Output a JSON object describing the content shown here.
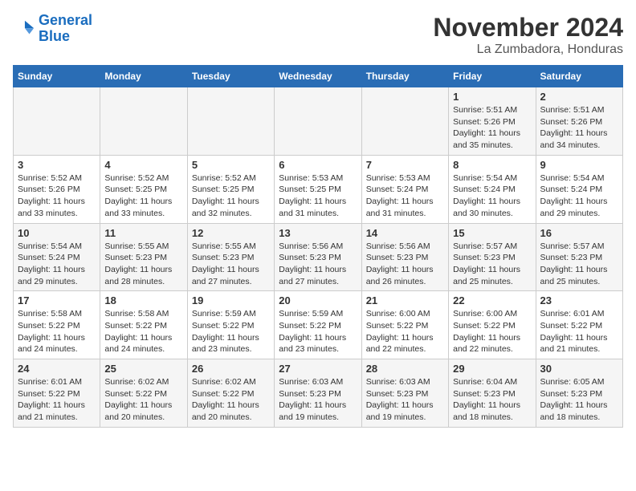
{
  "logo": {
    "line1": "General",
    "line2": "Blue"
  },
  "title": "November 2024",
  "subtitle": "La Zumbadora, Honduras",
  "weekdays": [
    "Sunday",
    "Monday",
    "Tuesday",
    "Wednesday",
    "Thursday",
    "Friday",
    "Saturday"
  ],
  "weeks": [
    [
      {
        "day": "",
        "info": ""
      },
      {
        "day": "",
        "info": ""
      },
      {
        "day": "",
        "info": ""
      },
      {
        "day": "",
        "info": ""
      },
      {
        "day": "",
        "info": ""
      },
      {
        "day": "1",
        "info": "Sunrise: 5:51 AM\nSunset: 5:26 PM\nDaylight: 11 hours\nand 35 minutes."
      },
      {
        "day": "2",
        "info": "Sunrise: 5:51 AM\nSunset: 5:26 PM\nDaylight: 11 hours\nand 34 minutes."
      }
    ],
    [
      {
        "day": "3",
        "info": "Sunrise: 5:52 AM\nSunset: 5:26 PM\nDaylight: 11 hours\nand 33 minutes."
      },
      {
        "day": "4",
        "info": "Sunrise: 5:52 AM\nSunset: 5:25 PM\nDaylight: 11 hours\nand 33 minutes."
      },
      {
        "day": "5",
        "info": "Sunrise: 5:52 AM\nSunset: 5:25 PM\nDaylight: 11 hours\nand 32 minutes."
      },
      {
        "day": "6",
        "info": "Sunrise: 5:53 AM\nSunset: 5:25 PM\nDaylight: 11 hours\nand 31 minutes."
      },
      {
        "day": "7",
        "info": "Sunrise: 5:53 AM\nSunset: 5:24 PM\nDaylight: 11 hours\nand 31 minutes."
      },
      {
        "day": "8",
        "info": "Sunrise: 5:54 AM\nSunset: 5:24 PM\nDaylight: 11 hours\nand 30 minutes."
      },
      {
        "day": "9",
        "info": "Sunrise: 5:54 AM\nSunset: 5:24 PM\nDaylight: 11 hours\nand 29 minutes."
      }
    ],
    [
      {
        "day": "10",
        "info": "Sunrise: 5:54 AM\nSunset: 5:24 PM\nDaylight: 11 hours\nand 29 minutes."
      },
      {
        "day": "11",
        "info": "Sunrise: 5:55 AM\nSunset: 5:23 PM\nDaylight: 11 hours\nand 28 minutes."
      },
      {
        "day": "12",
        "info": "Sunrise: 5:55 AM\nSunset: 5:23 PM\nDaylight: 11 hours\nand 27 minutes."
      },
      {
        "day": "13",
        "info": "Sunrise: 5:56 AM\nSunset: 5:23 PM\nDaylight: 11 hours\nand 27 minutes."
      },
      {
        "day": "14",
        "info": "Sunrise: 5:56 AM\nSunset: 5:23 PM\nDaylight: 11 hours\nand 26 minutes."
      },
      {
        "day": "15",
        "info": "Sunrise: 5:57 AM\nSunset: 5:23 PM\nDaylight: 11 hours\nand 25 minutes."
      },
      {
        "day": "16",
        "info": "Sunrise: 5:57 AM\nSunset: 5:23 PM\nDaylight: 11 hours\nand 25 minutes."
      }
    ],
    [
      {
        "day": "17",
        "info": "Sunrise: 5:58 AM\nSunset: 5:22 PM\nDaylight: 11 hours\nand 24 minutes."
      },
      {
        "day": "18",
        "info": "Sunrise: 5:58 AM\nSunset: 5:22 PM\nDaylight: 11 hours\nand 24 minutes."
      },
      {
        "day": "19",
        "info": "Sunrise: 5:59 AM\nSunset: 5:22 PM\nDaylight: 11 hours\nand 23 minutes."
      },
      {
        "day": "20",
        "info": "Sunrise: 5:59 AM\nSunset: 5:22 PM\nDaylight: 11 hours\nand 23 minutes."
      },
      {
        "day": "21",
        "info": "Sunrise: 6:00 AM\nSunset: 5:22 PM\nDaylight: 11 hours\nand 22 minutes."
      },
      {
        "day": "22",
        "info": "Sunrise: 6:00 AM\nSunset: 5:22 PM\nDaylight: 11 hours\nand 22 minutes."
      },
      {
        "day": "23",
        "info": "Sunrise: 6:01 AM\nSunset: 5:22 PM\nDaylight: 11 hours\nand 21 minutes."
      }
    ],
    [
      {
        "day": "24",
        "info": "Sunrise: 6:01 AM\nSunset: 5:22 PM\nDaylight: 11 hours\nand 21 minutes."
      },
      {
        "day": "25",
        "info": "Sunrise: 6:02 AM\nSunset: 5:22 PM\nDaylight: 11 hours\nand 20 minutes."
      },
      {
        "day": "26",
        "info": "Sunrise: 6:02 AM\nSunset: 5:22 PM\nDaylight: 11 hours\nand 20 minutes."
      },
      {
        "day": "27",
        "info": "Sunrise: 6:03 AM\nSunset: 5:23 PM\nDaylight: 11 hours\nand 19 minutes."
      },
      {
        "day": "28",
        "info": "Sunrise: 6:03 AM\nSunset: 5:23 PM\nDaylight: 11 hours\nand 19 minutes."
      },
      {
        "day": "29",
        "info": "Sunrise: 6:04 AM\nSunset: 5:23 PM\nDaylight: 11 hours\nand 18 minutes."
      },
      {
        "day": "30",
        "info": "Sunrise: 6:05 AM\nSunset: 5:23 PM\nDaylight: 11 hours\nand 18 minutes."
      }
    ]
  ]
}
